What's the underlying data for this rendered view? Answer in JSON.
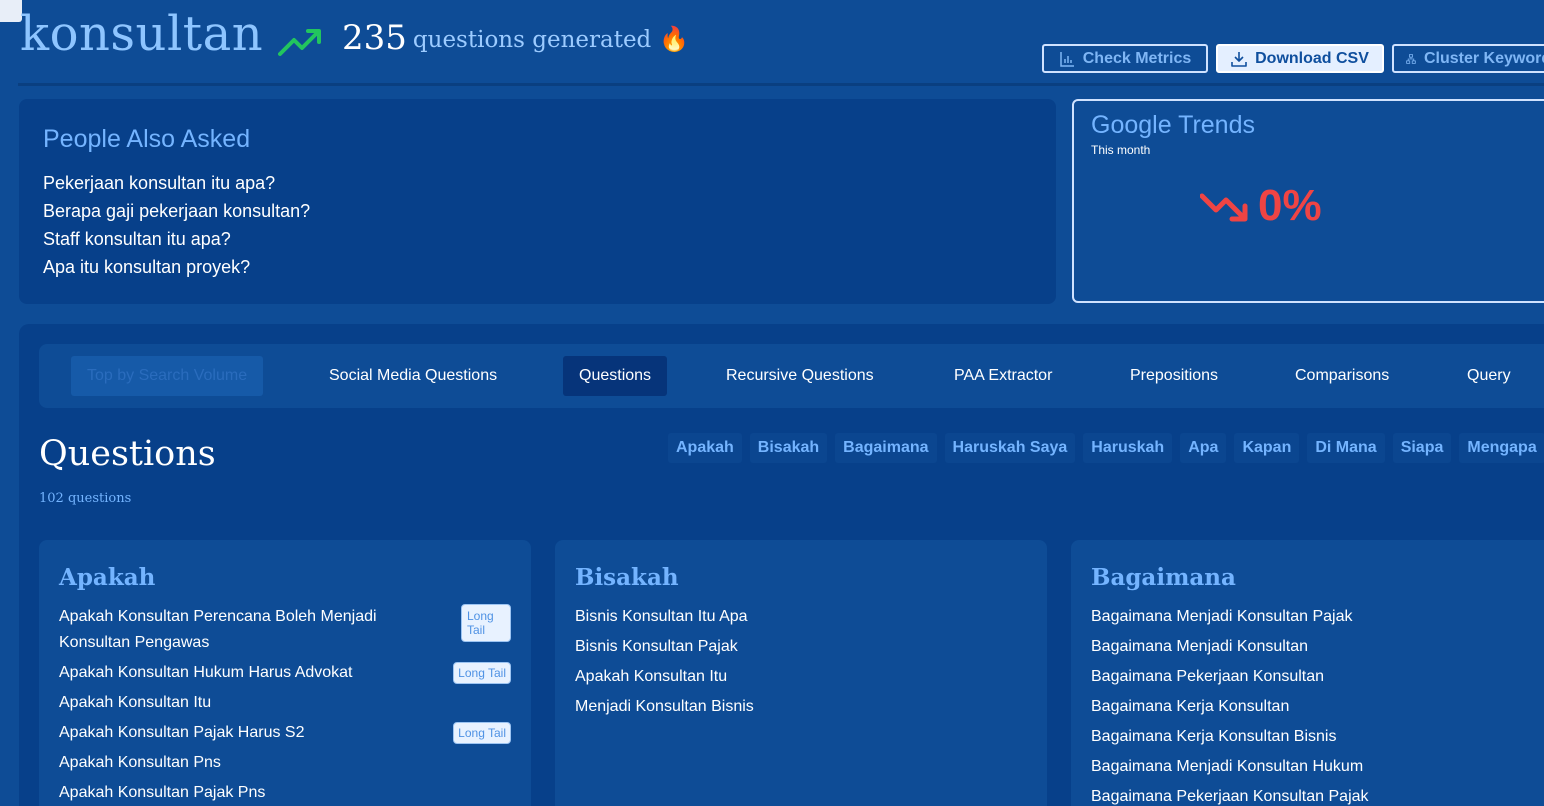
{
  "header": {
    "keyword": "konsultan",
    "count": "235",
    "count_label": "questions generated",
    "count_emoji": "🔥",
    "buttons": {
      "metrics": "Check Metrics",
      "download": "Download CSV",
      "cluster": "Cluster Keywords"
    }
  },
  "paa": {
    "title": "People Also Asked",
    "items": [
      "Pekerjaan konsultan itu apa?",
      "Berapa gaji pekerjaan konsultan?",
      "Staff konsultan itu apa?",
      "Apa itu konsultan proyek?"
    ]
  },
  "trends": {
    "title": "Google Trends",
    "period": "This month",
    "value": "0%"
  },
  "tabs": [
    "Top by Search Volume",
    "Social Media Questions",
    "Questions",
    "Recursive Questions",
    "PAA Extractor",
    "Prepositions",
    "Comparisons",
    "Query"
  ],
  "section": {
    "title": "Questions",
    "count": "102 questions",
    "chips": [
      "Apakah",
      "Bisakah",
      "Bagaimana",
      "Haruskah Saya",
      "Haruskah",
      "Apa",
      "Kapan",
      "Di Mana",
      "Siapa",
      "Mengapa"
    ]
  },
  "columns": [
    {
      "title": "Apakah",
      "items": [
        {
          "text": "Apakah Konsultan Perencana Boleh Menjadi Konsultan Pengawas",
          "badge": "Long Tail"
        },
        {
          "text": "Apakah Konsultan Hukum Harus Advokat",
          "badge": "Long Tail"
        },
        {
          "text": "Apakah Konsultan Itu",
          "badge": ""
        },
        {
          "text": "Apakah Konsultan Pajak Harus S2",
          "badge": "Long Tail"
        },
        {
          "text": "Apakah Konsultan Pns",
          "badge": ""
        },
        {
          "text": "Apakah Konsultan Pajak Pns",
          "badge": ""
        }
      ]
    },
    {
      "title": "Bisakah",
      "items": [
        {
          "text": "Bisnis Konsultan Itu Apa",
          "badge": ""
        },
        {
          "text": "Bisnis Konsultan Pajak",
          "badge": ""
        },
        {
          "text": "Apakah Konsultan Itu",
          "badge": ""
        },
        {
          "text": "Menjadi Konsultan Bisnis",
          "badge": ""
        }
      ]
    },
    {
      "title": "Bagaimana",
      "items": [
        {
          "text": "Bagaimana Menjadi Konsultan Pajak",
          "badge": ""
        },
        {
          "text": "Bagaimana Menjadi Konsultan",
          "badge": ""
        },
        {
          "text": "Bagaimana Pekerjaan Konsultan",
          "badge": ""
        },
        {
          "text": "Bagaimana Kerja Konsultan",
          "badge": ""
        },
        {
          "text": "Bagaimana Kerja Konsultan Bisnis",
          "badge": ""
        },
        {
          "text": "Bagaimana Menjadi Konsultan Hukum",
          "badge": ""
        },
        {
          "text": "Bagaimana Pekerjaan Konsultan Pajak",
          "badge": ""
        }
      ]
    }
  ]
}
